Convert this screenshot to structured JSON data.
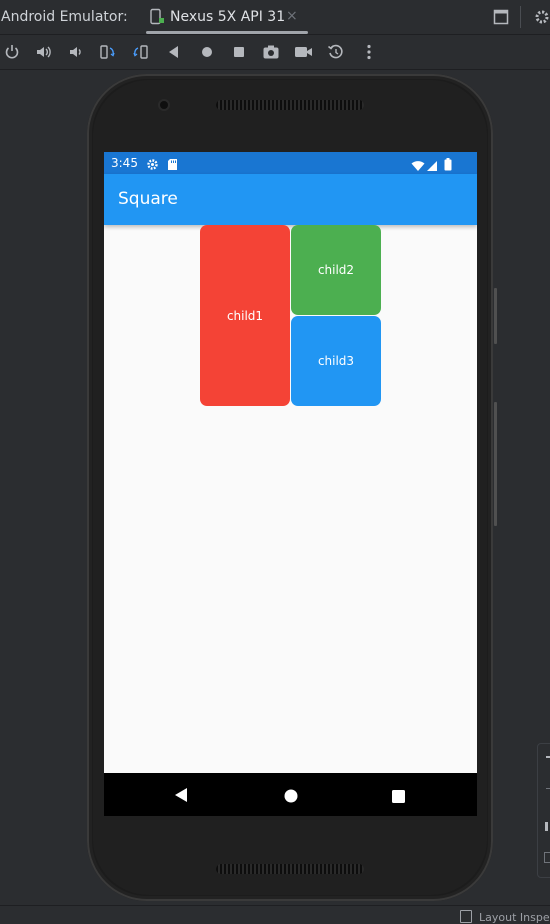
{
  "ide": {
    "title": "Android Emulator:",
    "tab": {
      "label": "Nexus 5X API 31",
      "close": "×"
    },
    "status_text": "Layout Inspe"
  },
  "toolbar": {
    "icons": [
      "power-icon",
      "volume-up-icon",
      "volume-down-icon",
      "rotate-left-icon",
      "rotate-right-icon",
      "back-icon",
      "home-icon",
      "overview-icon",
      "screenshot-icon",
      "record-icon",
      "snapshot-icon",
      "more-icon"
    ]
  },
  "device": {
    "status_bar": {
      "time": "3:45"
    },
    "app_bar": {
      "title": "Square"
    },
    "tiles": [
      {
        "label": "child1",
        "color": "#f44336"
      },
      {
        "label": "child2",
        "color": "#4caf50"
      },
      {
        "label": "child3",
        "color": "#2196f3"
      }
    ]
  },
  "colors": {
    "status_bar": "#1976d2",
    "app_bar": "#2196f3",
    "screen_bg": "#fafafa",
    "nav_bar": "#000000"
  }
}
